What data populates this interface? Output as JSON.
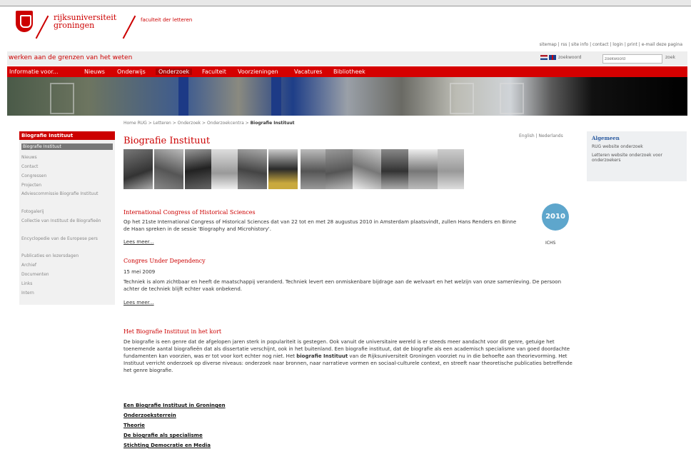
{
  "header": {
    "university": "rijksuniversiteit groningen",
    "faculty": "faculteit der letteren",
    "utility_links": "sitemap | rss | site info | contact | login | print | e-mail deze pagina",
    "slogan": "werken aan de grenzen van het weten",
    "search_placeholder": "zoekwoord",
    "search_button": "zoek",
    "lang_label": "zoekwoord"
  },
  "nav": [
    "Informatie voor...",
    "Nieuws",
    "Onderwijs",
    "Onderzoek",
    "Faculteit",
    "Voorzieningen",
    "Vacatures",
    "Bibliotheek"
  ],
  "breadcrumb": {
    "path": "Home RUG > Letteren > Onderzoek > Onderzoekcentra > ",
    "current": "Biografie Instituut"
  },
  "sidebar": {
    "title": "Biografie Instituut",
    "items": [
      "Biografie Instituut",
      "Nieuws",
      "Contact",
      "Congressen",
      "Projecten",
      "Adviescommissie Biografie Instituut",
      "Fotogalerij",
      "Collectie van Instituut de Biografieën",
      "Encyclopedie van de Europese pers",
      "Publicaties en lezersdagen",
      "Archief",
      "Documenten",
      "Links",
      "Intern"
    ]
  },
  "main": {
    "title": "Biografie Instituut",
    "lang_switch": "English | Nederlands",
    "news": [
      {
        "title": "International Congress of Historical Sciences",
        "text": "Op het 21ste International Congress of Historical Sciences dat van 22 tot en met 28 augustus 2010 in Amsterdam plaatsvindt, zullen Hans Renders en Binne de Haan spreken in de sessie 'Biography and Microhistory'.",
        "readmore": "Lees meer..."
      },
      {
        "title": "Congres Under Dependency",
        "date": "15 mei 2009",
        "text": "Techniek is alom zichtbaar en heeft de maatschappij veranderd. Techniek levert een onmiskenbare bijdrage aan de welvaart en het welzijn van onze samenleving. De persoon achter de techniek blijft echter vaak onbekend.",
        "readmore": "Lees meer..."
      }
    ],
    "about_title": "Het Biografie Instituut in het kort",
    "about_text_1": "De biografie is een genre dat de afgelopen jaren sterk in populariteit is gestegen. Ook vanuit de universitaire wereld is er steeds meer aandacht voor dit genre, getuige het toenemende aantal biografieën dat als dissertatie verschijnt, ook in het buitenland. Een biografie instituut, dat de biografie als een academisch specialisme van goed doordachte fundamenten kan voorzien, was er tot voor kort echter nog niet. Het ",
    "about_bold": "biografie Instituut",
    "about_text_2": " van de Rijksuniversiteit Groningen voorziet nu in die behoefte aan theorievorming. Het Instituut verricht onderzoek op diverse niveaus: onderzoek naar bronnen, naar narratieve vormen en sociaal-culturele context, en streeft naar theoretische publicaties betreffende het genre biografie.",
    "links": [
      "Een Biografie Instituut in Groningen",
      "Onderzoeksterrein",
      "Theorie",
      "De biografie als specialisme",
      "Stichting Democratie en Media"
    ],
    "badge": "2010",
    "badge_label": "ICHS"
  },
  "right": {
    "title": "Algemeen",
    "items": [
      "RUG website onderzoek",
      "Letteren website onderzoek voor onderzoekers"
    ]
  },
  "colors": {
    "brand_red": "#cc0000",
    "nav_red": "#d50000",
    "link_blue": "#2a5aa0"
  }
}
